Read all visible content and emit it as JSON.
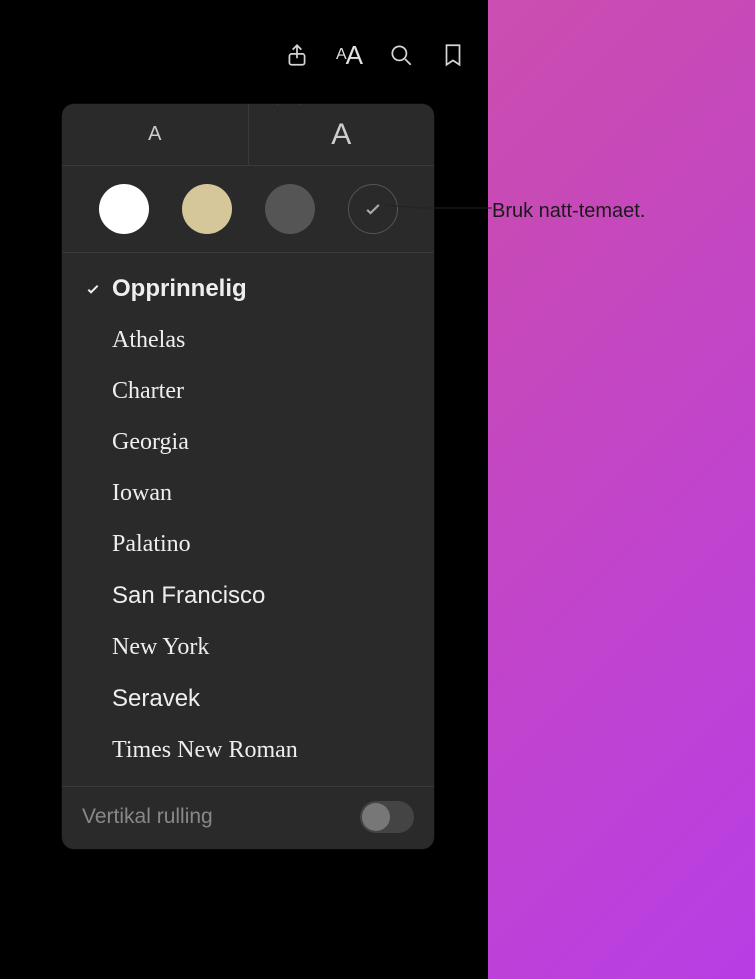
{
  "toolbar": {
    "share": "share-icon",
    "appearance": "appearance-icon",
    "search": "search-icon",
    "bookmark": "bookmark-icon"
  },
  "popover": {
    "sizeSmall": "A",
    "sizeLarge": "A",
    "themes": {
      "white": "#ffffff",
      "sepia": "#d6c79a",
      "gray": "#555555",
      "night": "#2a2a2a"
    },
    "fonts": [
      {
        "name": "Opprinnelig",
        "selected": true,
        "class": ""
      },
      {
        "name": "Athelas",
        "selected": false,
        "class": "font-athelas"
      },
      {
        "name": "Charter",
        "selected": false,
        "class": "font-charter"
      },
      {
        "name": "Georgia",
        "selected": false,
        "class": "font-georgia"
      },
      {
        "name": "Iowan",
        "selected": false,
        "class": "font-iowan"
      },
      {
        "name": "Palatino",
        "selected": false,
        "class": "font-palatino"
      },
      {
        "name": "San Francisco",
        "selected": false,
        "class": "font-sf"
      },
      {
        "name": "New York",
        "selected": false,
        "class": "font-ny"
      },
      {
        "name": "Seravek",
        "selected": false,
        "class": "font-seravek"
      },
      {
        "name": "Times New Roman",
        "selected": false,
        "class": "font-tnr"
      }
    ],
    "footer": {
      "label": "Vertikal rulling",
      "toggleOn": false
    }
  },
  "callout": {
    "text": "Bruk natt-temaet."
  }
}
